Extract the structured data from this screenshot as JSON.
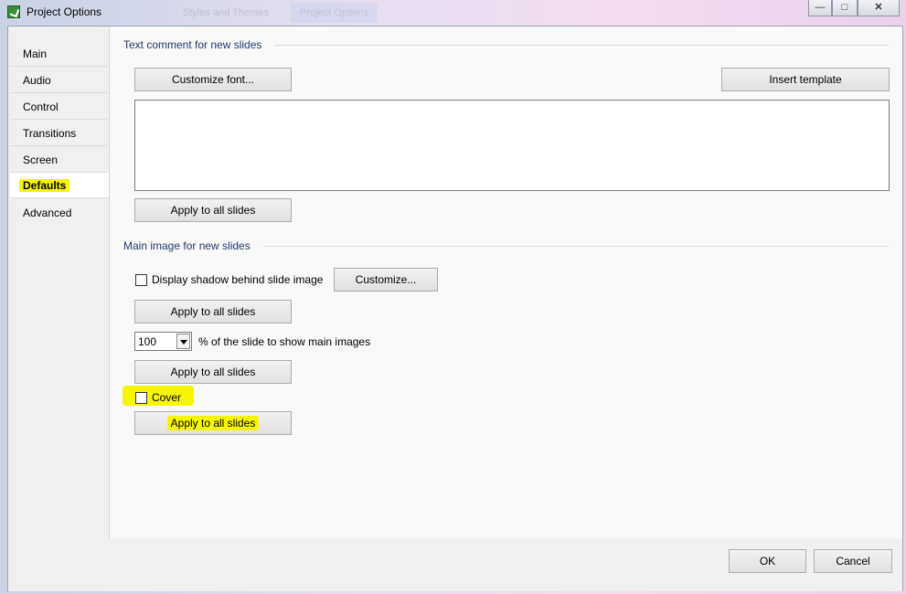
{
  "window": {
    "title": "Project Options",
    "background_tabs": [
      "Styles and Themes",
      "Project Options"
    ],
    "controls": [
      "—",
      "□",
      "✕"
    ]
  },
  "sidebar": {
    "items": [
      {
        "label": "Main"
      },
      {
        "label": "Audio"
      },
      {
        "label": "Control"
      },
      {
        "label": "Transitions"
      },
      {
        "label": "Screen"
      },
      {
        "label": "Defaults",
        "active": true
      },
      {
        "label": "Advanced"
      }
    ]
  },
  "text_comment": {
    "section_title": "Text comment for new slides",
    "customize_font": "Customize font...",
    "insert_template": "Insert template",
    "comment_value": "",
    "apply": "Apply to all slides"
  },
  "main_image": {
    "section_title": "Main image for new slides",
    "shadow_label": "Display shadow behind slide image",
    "shadow_checked": false,
    "customize": "Customize...",
    "apply_shadow": "Apply to all slides",
    "percent_value": "100",
    "percent_label": "% of the slide to show main images",
    "apply_percent": "Apply to all slides",
    "cover_label": "Cover",
    "cover_checked": false,
    "apply_cover": "Apply to all slides"
  },
  "footer": {
    "ok": "OK",
    "cancel": "Cancel"
  },
  "colors": {
    "highlight": "#f7f500",
    "section_title": "#1e3a6e"
  }
}
